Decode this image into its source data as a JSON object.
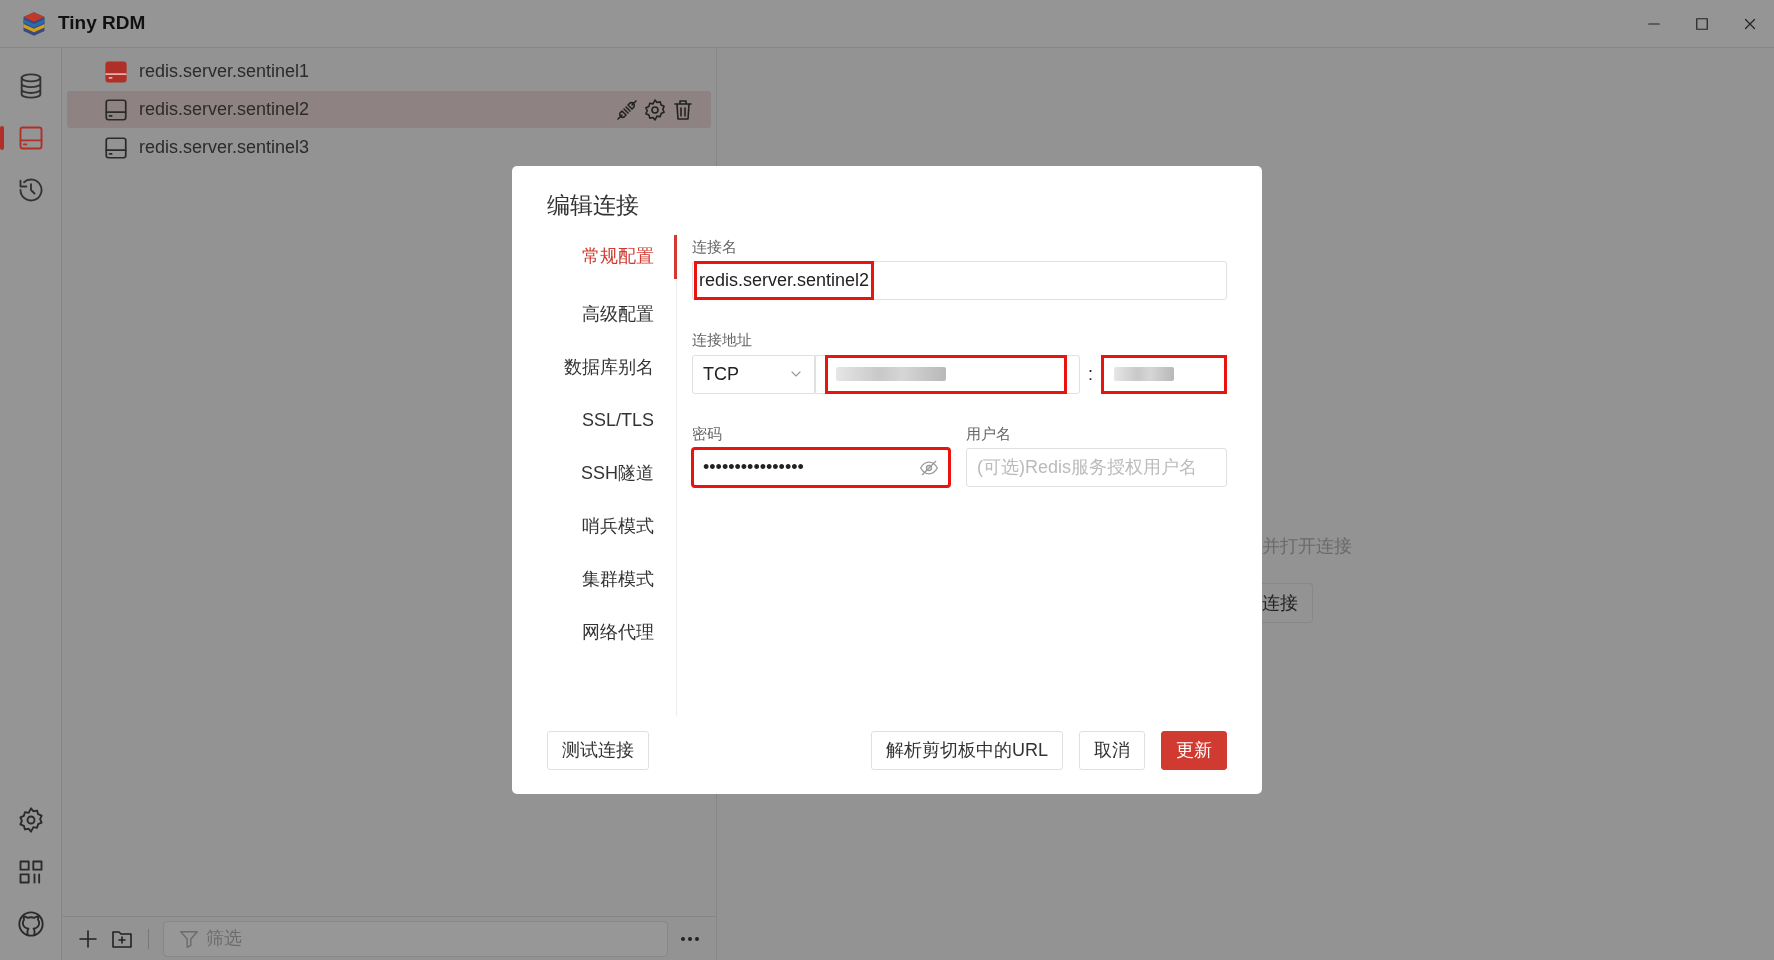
{
  "window": {
    "title": "Tiny RDM"
  },
  "rail": {
    "top": [
      {
        "selected": false
      },
      {
        "selected": true
      },
      {
        "selected": false
      }
    ]
  },
  "connections": [
    {
      "name": "redis.server.sentinel1",
      "connected": true,
      "selected": false
    },
    {
      "name": "redis.server.sentinel2",
      "connected": false,
      "selected": true
    },
    {
      "name": "redis.server.sentinel3",
      "connected": false,
      "selected": false
    }
  ],
  "filter": {
    "placeholder": "筛选"
  },
  "welcome": {
    "text": "并打开连接",
    "button": "连接"
  },
  "dialog": {
    "title": "编辑连接",
    "nav": [
      {
        "label": "常规配置",
        "selected": true
      },
      {
        "label": "高级配置",
        "selected": false
      },
      {
        "label": "数据库别名",
        "selected": false
      },
      {
        "label": "SSL/TLS",
        "selected": false
      },
      {
        "label": "SSH隧道",
        "selected": false
      },
      {
        "label": "哨兵模式",
        "selected": false
      },
      {
        "label": "集群模式",
        "selected": false
      },
      {
        "label": "网络代理",
        "selected": false
      }
    ],
    "name": {
      "label": "连接名",
      "value": "redis.server.sentinel2",
      "highlighted": true
    },
    "address": {
      "label": "连接地址",
      "protocol": "TCP",
      "host_highlighted": true,
      "separator": ":",
      "port_highlighted": true
    },
    "password": {
      "label": "密码",
      "value": "••••••••••••••••",
      "highlighted": true
    },
    "username": {
      "label": "用户名",
      "placeholder": "(可选)Redis服务授权用户名"
    },
    "buttons": [
      {
        "label": "测试连接",
        "kind": "default"
      },
      {
        "label": "解析剪切板中的URL",
        "kind": "default"
      },
      {
        "label": "取消",
        "kind": "default"
      },
      {
        "label": "更新",
        "kind": "primary"
      }
    ]
  }
}
